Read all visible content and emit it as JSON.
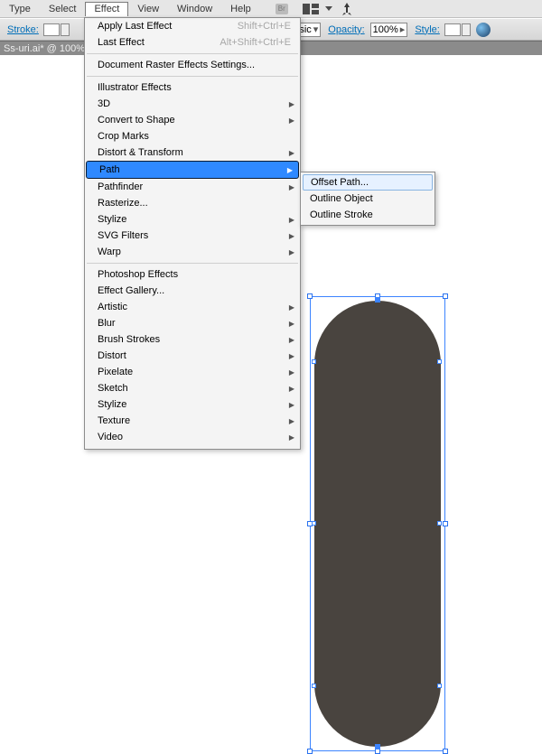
{
  "menubar": {
    "items": [
      "Type",
      "Select",
      "Effect",
      "View",
      "Window",
      "Help"
    ],
    "active_index": 2
  },
  "ctrlbar": {
    "stroke_label": "Stroke:",
    "opacity_label": "Opacity:",
    "opacity_value": "100%",
    "style_label": "Style:",
    "basic_label": "Basic"
  },
  "doctab": {
    "title": "Ss-uri.ai* @ 100%"
  },
  "dropdown": {
    "recent": [
      {
        "label": "Apply Last Effect",
        "shortcut": "Shift+Ctrl+E",
        "disabled": true
      },
      {
        "label": "Last Effect",
        "shortcut": "Alt+Shift+Ctrl+E",
        "disabled": true
      }
    ],
    "raster": "Document Raster Effects Settings...",
    "illustrator_heading": "Illustrator Effects",
    "illustrator": [
      {
        "label": "3D",
        "submenu": true
      },
      {
        "label": "Convert to Shape",
        "submenu": true
      },
      {
        "label": "Crop Marks",
        "submenu": false
      },
      {
        "label": "Distort & Transform",
        "submenu": true
      },
      {
        "label": "Path",
        "submenu": true,
        "highlight": true
      },
      {
        "label": "Pathfinder",
        "submenu": true
      },
      {
        "label": "Rasterize...",
        "submenu": false
      },
      {
        "label": "Stylize",
        "submenu": true
      },
      {
        "label": "SVG Filters",
        "submenu": true
      },
      {
        "label": "Warp",
        "submenu": true
      }
    ],
    "photoshop_heading": "Photoshop Effects",
    "photoshop": [
      {
        "label": "Effect Gallery...",
        "submenu": false
      },
      {
        "label": "Artistic",
        "submenu": true
      },
      {
        "label": "Blur",
        "submenu": true
      },
      {
        "label": "Brush Strokes",
        "submenu": true
      },
      {
        "label": "Distort",
        "submenu": true
      },
      {
        "label": "Pixelate",
        "submenu": true
      },
      {
        "label": "Sketch",
        "submenu": true
      },
      {
        "label": "Stylize",
        "submenu": true
      },
      {
        "label": "Texture",
        "submenu": true
      },
      {
        "label": "Video",
        "submenu": true
      }
    ]
  },
  "flyout": {
    "items": [
      {
        "label": "Offset Path...",
        "hover": true
      },
      {
        "label": "Outline Object"
      },
      {
        "label": "Outline Stroke"
      }
    ]
  }
}
